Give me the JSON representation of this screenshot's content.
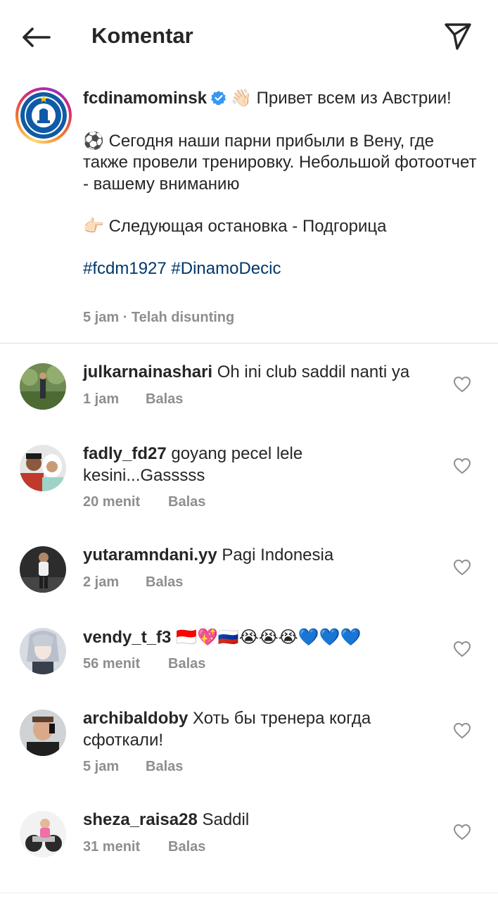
{
  "header": {
    "title": "Komentar",
    "back_icon": "arrow-left-icon",
    "share_icon": "paper-plane-icon"
  },
  "caption": {
    "username": "fcdinamominsk",
    "verified": true,
    "emoji_wave": "👋🏻",
    "line1": "Привет всем из Австрии!",
    "emoji_ball": "⚽",
    "line2": "Сегодня наши парни прибыли в Вену, где также провели тренировку. Небольшой фотоотчет - вашему вниманию",
    "emoji_point": "👉🏻",
    "line3": "Следующая остановка - Подгорица",
    "hashtags": [
      "#fcdm1927",
      "#DinamoDecic"
    ],
    "time": "5 jam",
    "edited": "· Telah disunting"
  },
  "comments": [
    {
      "username": "julkarnainashari",
      "text": "Oh ini club saddil nanti ya",
      "time": "1 jam",
      "reply": "Balas"
    },
    {
      "username": "fadly_fd27",
      "text": "goyang pecel lele kesini...Gasssss",
      "time": "20 menit",
      "reply": "Balas"
    },
    {
      "username": "yutaramndani.yy",
      "text": "Pagi Indonesia",
      "time": "2 jam",
      "reply": "Balas"
    },
    {
      "username": "vendy_t_f3",
      "text": "🇮🇩💖🇷🇺😭😭😭💙💙💙",
      "time": "56 menit",
      "reply": "Balas"
    },
    {
      "username": "archibaldoby",
      "text": "Хоть бы тренера когда сфоткали!",
      "time": "5 jam",
      "reply": "Balas"
    },
    {
      "username": "sheza_raisa28",
      "text": "Saddil",
      "time": "31 menit",
      "reply": "Balas"
    }
  ],
  "colors": {
    "text": "#262626",
    "secondary": "#8e8e8e",
    "hashtag": "#00376b",
    "verified": "#3897f0",
    "divider": "#dbdbdb"
  }
}
